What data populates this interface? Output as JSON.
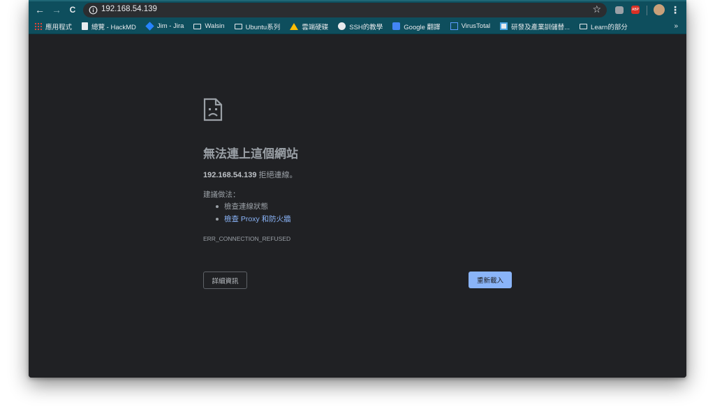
{
  "toolbar": {
    "back_icon": "←",
    "forward_icon": "→",
    "reload_icon": "C",
    "url": "192.168.54.139",
    "star_icon": "☆",
    "menu_icon": "⋮"
  },
  "bookmarks": {
    "items": [
      {
        "label": "應用程式",
        "icon": "apps-grid-icon"
      },
      {
        "label": "總覽 - HackMD",
        "icon": "document-icon"
      },
      {
        "label": "Jim - Jira",
        "icon": "jira-icon"
      },
      {
        "label": "Walsin",
        "icon": "folder-icon"
      },
      {
        "label": "Ubuntu系列",
        "icon": "folder-icon"
      },
      {
        "label": "雲端硬碟",
        "icon": "google-drive-icon"
      },
      {
        "label": "SSH的教學",
        "icon": "github-icon"
      },
      {
        "label": "Google 翻譯",
        "icon": "google-translate-icon"
      },
      {
        "label": "VirusTotal",
        "icon": "virustotal-icon"
      },
      {
        "label": "研發及產業訓儲替...",
        "icon": "site-icon"
      },
      {
        "label": "Learn的部分",
        "icon": "folder-icon"
      }
    ],
    "more": "»"
  },
  "error": {
    "title": "無法連上這個網站",
    "host": "192.168.54.139",
    "refused_text": " 拒絕連線。",
    "suggest_label": "建議做法：",
    "suggestions": [
      "檢查連線狀態",
      "檢查 Proxy 和防火牆"
    ],
    "code": "ERR_CONNECTION_REFUSED",
    "details_button": "詳細資訊",
    "reload_button": "重新載入"
  },
  "colors": {
    "toolbar": "#0e4e5d",
    "page_bg": "#202124",
    "accent": "#8ab4f8",
    "text": "#9aa0a6"
  }
}
